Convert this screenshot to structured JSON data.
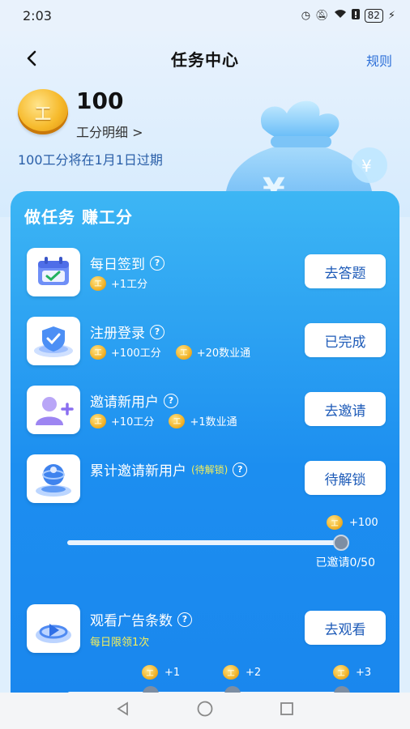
{
  "status_bar": {
    "time": "2:03",
    "battery": "82"
  },
  "nav": {
    "title": "任务中心",
    "rules_label": "规则"
  },
  "points": {
    "coin_glyph": "工",
    "value": "100",
    "detail_link": "工分明细 >",
    "expire_note": "100工分将在1月1日过期"
  },
  "card": {
    "title": "做任务 赚工分"
  },
  "tasks": [
    {
      "name": "每日签到",
      "rewards": [
        "+1工分"
      ],
      "button": "去答题",
      "icon": "calendar-check-icon"
    },
    {
      "name": "注册登录",
      "rewards": [
        "+100工分",
        "+20数业通"
      ],
      "button": "已完成",
      "icon": "shield-check-icon"
    },
    {
      "name": "邀请新用户",
      "rewards": [
        "+10工分",
        "+1数业通"
      ],
      "button": "去邀请",
      "icon": "user-add-icon"
    },
    {
      "name": "累计邀请新用户",
      "locked_tag": "(待解锁)",
      "button": "待解锁",
      "icon": "globe-icon",
      "progress": {
        "reward": "+100",
        "invited_text": "已邀请0/50",
        "fraction": 0
      }
    },
    {
      "name": "观看广告条数",
      "daily_limit": "每日限领1次",
      "button": "去观看",
      "icon": "play-video-icon",
      "step_rewards": [
        "+1",
        "+2",
        "+3"
      ]
    }
  ],
  "colors": {
    "card_top": "#3db6f4",
    "card_bottom": "#1a87ee",
    "button_text": "#1e5bb8",
    "highlight_yellow": "#f5ef5a"
  }
}
